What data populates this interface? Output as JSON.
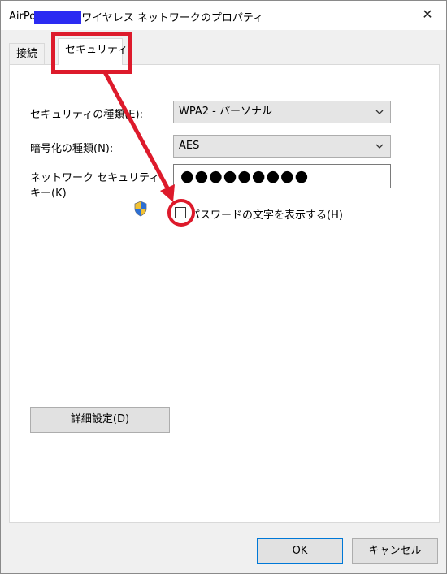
{
  "window": {
    "title_prefix": "AirPo",
    "title_suffix": "ワイヤレス ネットワークのプロパティ",
    "close_symbol": "✕"
  },
  "tabs": [
    {
      "label": "接続",
      "selected": false
    },
    {
      "label": "セキュリティ",
      "selected": true
    }
  ],
  "security": {
    "type_label": "セキュリティの種類(E):",
    "type_value": "WPA2 - パーソナル",
    "encryption_label": "暗号化の種類(N):",
    "encryption_value": "AES",
    "key_label_line1": "ネットワーク セキュリティ",
    "key_label_line2": "キー(K)",
    "key_value": "●●●●●●●●●",
    "show_password_label": "パスワードの文字を表示する(H)",
    "show_password_checked": false
  },
  "buttons": {
    "advanced": "詳細設定(D)",
    "ok": "OK",
    "cancel": "キャンセル"
  },
  "annotation_color": "#dd1a2b",
  "icons": {
    "shield": "uac-shield-icon",
    "dropdown": "chevron-down-icon"
  }
}
